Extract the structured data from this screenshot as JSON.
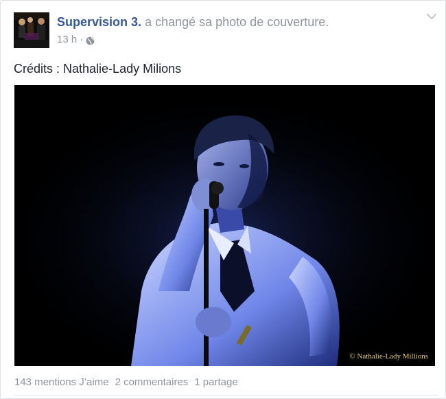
{
  "post": {
    "author": "Supervision 3.",
    "action": "a changé sa photo de couverture.",
    "time": "13 h",
    "separator": "·",
    "audience_icon": "globe-icon",
    "menu_icon": "chevron-down-icon",
    "text": "Crédits : Nathalie-Lady Milions",
    "photo_watermark": "© Nathalie-Lady Millions"
  },
  "stats": {
    "likes": "143 mentions J’aime",
    "comments": "2 commentaires",
    "shares": "1 partage"
  },
  "colors": {
    "author_link": "#365899",
    "meta_text": "#90949c",
    "photo_light": "#4a6cff"
  }
}
